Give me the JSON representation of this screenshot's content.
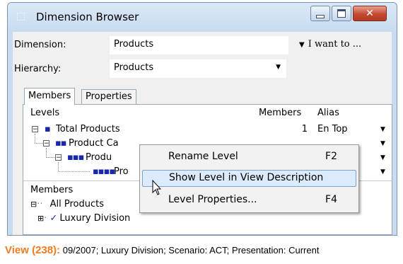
{
  "window": {
    "title": "Dimension Browser",
    "close_glyph": "✕"
  },
  "fields": {
    "dimension_label": "Dimension:",
    "dimension_value": "Products",
    "hierarchy_label": "Hierarchy:",
    "hierarchy_value": "Products",
    "action_menu_label": "I want to ..."
  },
  "tabs": [
    {
      "label": "Members",
      "active": true
    },
    {
      "label": "Properties",
      "active": false
    }
  ],
  "levels": {
    "headers": {
      "levels": "Levels",
      "members": "Members",
      "alias": "Alias"
    },
    "rows": [
      {
        "name": "Total Products",
        "members": "1",
        "alias": "En Top"
      },
      {
        "name": "Product Ca",
        "members": "",
        "alias": ""
      },
      {
        "name": "Produ",
        "members": "",
        "alias": ""
      },
      {
        "name": "Pro",
        "members": "",
        "alias": ""
      }
    ]
  },
  "members": {
    "header": "Members",
    "items": [
      {
        "name": "All Products"
      },
      {
        "name": "Luxury Division",
        "checked": true
      }
    ]
  },
  "context_menu": {
    "items": [
      {
        "label": "Rename Level",
        "shortcut": "F2",
        "highlighted": false
      },
      {
        "label": "Show Level in View Description",
        "shortcut": "",
        "highlighted": true
      },
      {
        "label": "Level Properties...",
        "shortcut": "F4",
        "highlighted": false
      }
    ]
  },
  "status": {
    "view_label": "View (238):",
    "view_text": "09/2007; Luxury Division; Scenario: ACT; Presentation: Current"
  },
  "colors": {
    "view_label": "#ef7b22",
    "level_dots": "#1727a8",
    "highlight": "#dcebfb"
  }
}
